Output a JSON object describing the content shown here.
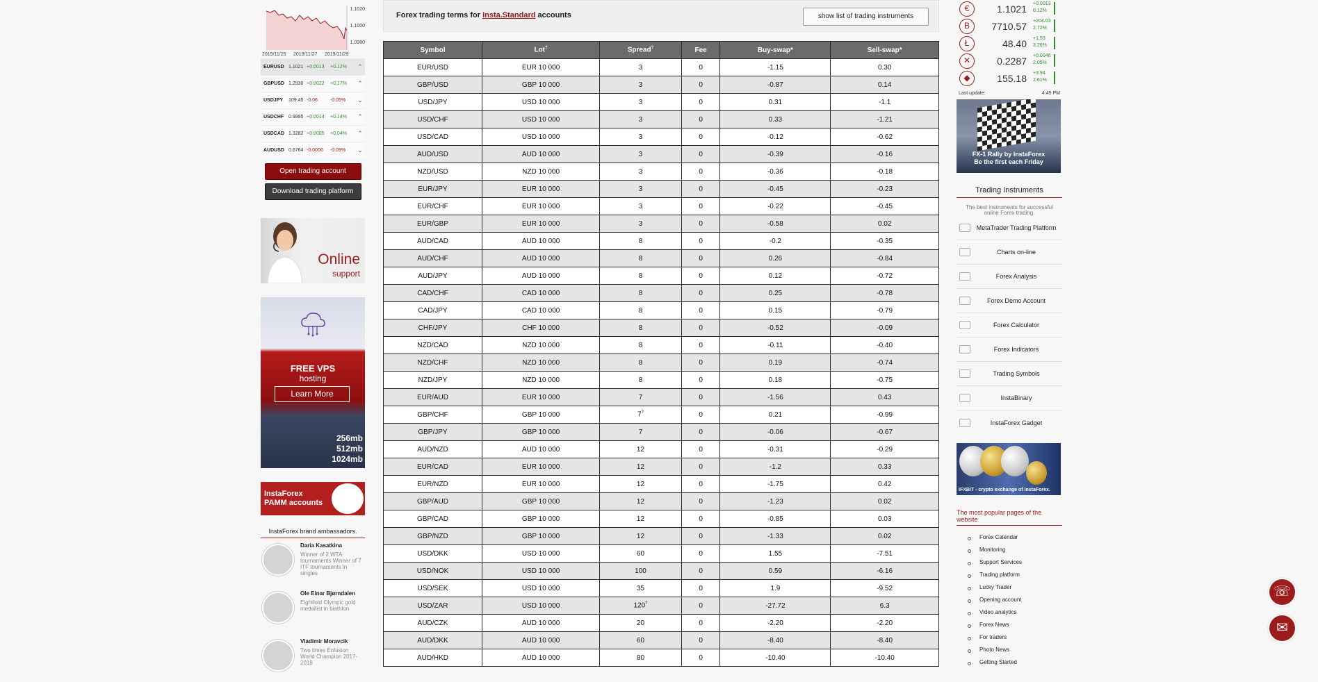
{
  "mini_chart": {
    "y_ticks": [
      "1.1020",
      "1.1000",
      "1.0980"
    ],
    "x_ticks": [
      "2019/11/25",
      "2019/11/27",
      "2019/11/29"
    ]
  },
  "quotes": [
    {
      "symbol": "EURUSD",
      "price": "1.1021",
      "change": "+0.0013",
      "pct": "+0.12%",
      "dir": "up"
    },
    {
      "symbol": "GBPUSD",
      "price": "1.2930",
      "change": "+0.0022",
      "pct": "+0.17%",
      "dir": "up"
    },
    {
      "symbol": "USDJPY",
      "price": "109.45",
      "change": "-0.06",
      "pct": "-0.05%",
      "dir": "down"
    },
    {
      "symbol": "USDCHF",
      "price": "0.9995",
      "change": "+0.0014",
      "pct": "+0.14%",
      "dir": "up"
    },
    {
      "symbol": "USDCAD",
      "price": "1.3282",
      "change": "+0.0005",
      "pct": "+0.04%",
      "dir": "up"
    },
    {
      "symbol": "AUDUSD",
      "price": "0.6764",
      "change": "-0.0006",
      "pct": "-0.09%",
      "dir": "down"
    }
  ],
  "buttons": {
    "open_account": "Open trading account",
    "download_platform": "Download trading platform"
  },
  "support": {
    "online": "Online",
    "sub": "support"
  },
  "vps": {
    "title": "FREE VPS",
    "sub": "hosting",
    "learn": "Learn More",
    "size1": "256mb",
    "size2": "512mb",
    "size3": "1024mb"
  },
  "pamm": {
    "line1": "InstaForex",
    "line2": "PAMM accounts"
  },
  "ambassadors": {
    "title": "InstaForex brand ambassadors.",
    "list": [
      {
        "name": "Daria Kasatkina",
        "desc": "Winner of 2 WTA tournaments Winner of 7 ITF tournaments in singles"
      },
      {
        "name": "Ole Einar Bjørndalen",
        "desc": "Eightfold Olympic gold medallist in biathlon"
      },
      {
        "name": "Vladimir Moravcik",
        "desc": "Two times Enfusion World Champion 2017-2018"
      }
    ]
  },
  "header": {
    "prefix": "Forex trading terms for ",
    "link": "Insta.Standard",
    "suffix": " accounts",
    "show_button": "show list of trading instruments"
  },
  "table": {
    "columns": [
      "Symbol",
      "Lot",
      "Spread",
      "Fee",
      "Buy-swap*",
      "Sell-swap*"
    ],
    "rows": [
      [
        "EUR/USD",
        "EUR 10 000",
        "3",
        "0",
        "-1.15",
        "0.30"
      ],
      [
        "GBP/USD",
        "GBP 10 000",
        "3",
        "0",
        "-0.87",
        "0.14"
      ],
      [
        "USD/JPY",
        "USD 10 000",
        "3",
        "0",
        "0.31",
        "-1.1"
      ],
      [
        "USD/CHF",
        "USD 10 000",
        "3",
        "0",
        "0.33",
        "-1.21"
      ],
      [
        "USD/CAD",
        "USD 10 000",
        "3",
        "0",
        "-0.12",
        "-0.62"
      ],
      [
        "AUD/USD",
        "AUD 10 000",
        "3",
        "0",
        "-0.39",
        "-0.16"
      ],
      [
        "NZD/USD",
        "NZD 10 000",
        "3",
        "0",
        "-0.36",
        "-0.18"
      ],
      [
        "EUR/JPY",
        "EUR 10 000",
        "3",
        "0",
        "-0.45",
        "-0.23"
      ],
      [
        "EUR/CHF",
        "EUR 10 000",
        "3",
        "0",
        "-0.22",
        "-0.45"
      ],
      [
        "EUR/GBP",
        "EUR 10 000",
        "3",
        "0",
        "-0.58",
        "0.02"
      ],
      [
        "AUD/CAD",
        "AUD 10 000",
        "8",
        "0",
        "-0.2",
        "-0.35"
      ],
      [
        "AUD/CHF",
        "AUD 10 000",
        "8",
        "0",
        "0.26",
        "-0.84"
      ],
      [
        "AUD/JPY",
        "AUD 10 000",
        "8",
        "0",
        "0.12",
        "-0.72"
      ],
      [
        "CAD/CHF",
        "CAD 10 000",
        "8",
        "0",
        "0.25",
        "-0.78"
      ],
      [
        "CAD/JPY",
        "CAD 10 000",
        "8",
        "0",
        "0.15",
        "-0.79"
      ],
      [
        "CHF/JPY",
        "CHF 10 000",
        "8",
        "0",
        "-0.52",
        "-0.09"
      ],
      [
        "NZD/CAD",
        "NZD 10 000",
        "8",
        "0",
        "-0.11",
        "-0.40"
      ],
      [
        "NZD/CHF",
        "NZD 10 000",
        "8",
        "0",
        "0.19",
        "-0.74"
      ],
      [
        "NZD/JPY",
        "NZD 10 000",
        "8",
        "0",
        "0.18",
        "-0.75"
      ],
      [
        "EUR/AUD",
        "EUR 10 000",
        "7",
        "0",
        "-1.56",
        "0.43"
      ],
      [
        "GBP/CHF",
        "GBP 10 000",
        "7",
        "0",
        "0.21",
        "-0.99"
      ],
      [
        "GBP/JPY",
        "GBP 10 000",
        "7",
        "0",
        "-0.06",
        "-0.67"
      ],
      [
        "AUD/NZD",
        "AUD 10 000",
        "12",
        "0",
        "-0.31",
        "-0.29"
      ],
      [
        "EUR/CAD",
        "EUR 10 000",
        "12",
        "0",
        "-1.2",
        "0.33"
      ],
      [
        "EUR/NZD",
        "EUR 10 000",
        "12",
        "0",
        "-1.75",
        "0.42"
      ],
      [
        "GBP/AUD",
        "GBP 10 000",
        "12",
        "0",
        "-1.23",
        "0.02"
      ],
      [
        "GBP/CAD",
        "GBP 10 000",
        "12",
        "0",
        "-0.85",
        "0.03"
      ],
      [
        "GBP/NZD",
        "GBP 10 000",
        "12",
        "0",
        "-1.33",
        "0.02"
      ],
      [
        "USD/DKK",
        "USD 10 000",
        "60",
        "0",
        "1.55",
        "-7.51"
      ],
      [
        "USD/NOK",
        "USD 10 000",
        "100",
        "0",
        "0.59",
        "-6.16"
      ],
      [
        "USD/SEK",
        "USD 10 000",
        "35",
        "0",
        "1.9",
        "-9.52"
      ],
      [
        "USD/ZAR",
        "USD 10 000",
        "120",
        "0",
        "-27.72",
        "6.3"
      ],
      [
        "AUD/CZK",
        "AUD 10 000",
        "20",
        "0",
        "-2.20",
        "-2.20"
      ],
      [
        "AUD/DKK",
        "AUD 10 000",
        "60",
        "0",
        "-8.40",
        "-8.40"
      ],
      [
        "AUD/HKD",
        "AUD 10 000",
        "80",
        "0",
        "-10.40",
        "-10.40"
      ]
    ]
  },
  "crypto": [
    {
      "icon": "euro-icon",
      "symbol": "€",
      "price": "1.1021",
      "ch1": "+0.0013",
      "ch2": "0.12%"
    },
    {
      "icon": "bitcoin-icon",
      "symbol": "B",
      "price": "7710.57",
      "ch1": "+204.03",
      "ch2": "2.72%"
    },
    {
      "icon": "litecoin-icon",
      "symbol": "Ł",
      "price": "48.40",
      "ch1": "+1.53",
      "ch2": "3.26%"
    },
    {
      "icon": "ripple-icon",
      "symbol": "✕",
      "price": "0.2287",
      "ch1": "+0.0046",
      "ch2": "2.05%"
    },
    {
      "icon": "ethereum-icon",
      "symbol": "◆",
      "price": "155.18",
      "ch1": "+3.94",
      "ch2": "2.61%"
    }
  ],
  "last_update": {
    "label": "Last update:",
    "time": "4:45 PM"
  },
  "rally": {
    "line1": "FX-1 Rally by InstaForex",
    "line2": "Be the first each Friday"
  },
  "instruments": {
    "title": "Trading Instruments",
    "desc": "The best instruments for successful online Forex trading.",
    "items": [
      {
        "label": "MetaTrader Trading Platform",
        "icon": "metatrader-icon"
      },
      {
        "label": "Charts on-line",
        "icon": "chart-icon"
      },
      {
        "label": "Forex Analysis",
        "icon": "analysis-icon"
      },
      {
        "label": "Forex Demo Account",
        "icon": "demo-icon"
      },
      {
        "label": "Forex Calculator",
        "icon": "calculator-icon"
      },
      {
        "label": "Forex Indicators",
        "icon": "indicators-icon"
      },
      {
        "label": "Trading Symbols",
        "icon": "symbols-icon"
      },
      {
        "label": "InstaBinary",
        "icon": "binary-icon"
      },
      {
        "label": "InstaForex Gadget",
        "icon": "gadget-icon"
      }
    ]
  },
  "ifxbit": {
    "text": "IFXBIT - crypto exchange of InstaForex."
  },
  "popular": {
    "title": "The most popular pages of the website",
    "items": [
      "Forex Calendar",
      "Monitoring",
      "Support Services",
      "Trading platform",
      "Lucky Trader",
      "Opening account",
      "Video analytics",
      "Forex News",
      "For traders",
      "Photo News",
      "Getting Started"
    ]
  },
  "float": {
    "phone": "☏",
    "chat": "✉"
  }
}
